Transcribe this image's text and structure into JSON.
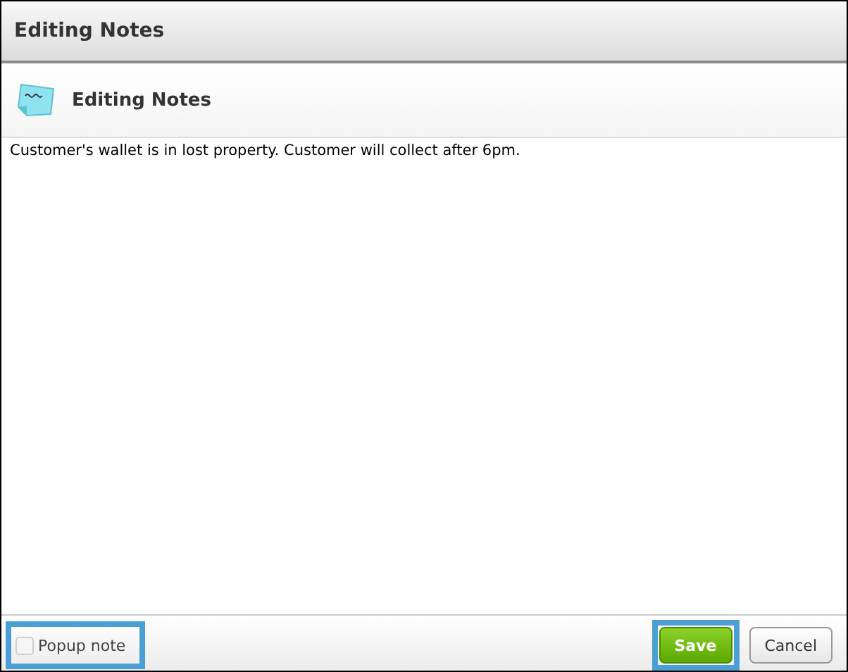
{
  "window": {
    "title": "Editing Notes"
  },
  "header": {
    "title": "Editing Notes"
  },
  "note": {
    "value": "Customer's wallet is in lost property. Customer will collect after 6pm."
  },
  "popup_note": {
    "label": "Popup note",
    "checked": false,
    "highlighted": true
  },
  "buttons": [
    {
      "label": "Save",
      "kind": "primary",
      "highlighted": true
    },
    {
      "label": "Cancel",
      "kind": "secondary",
      "highlighted": false
    }
  ]
}
